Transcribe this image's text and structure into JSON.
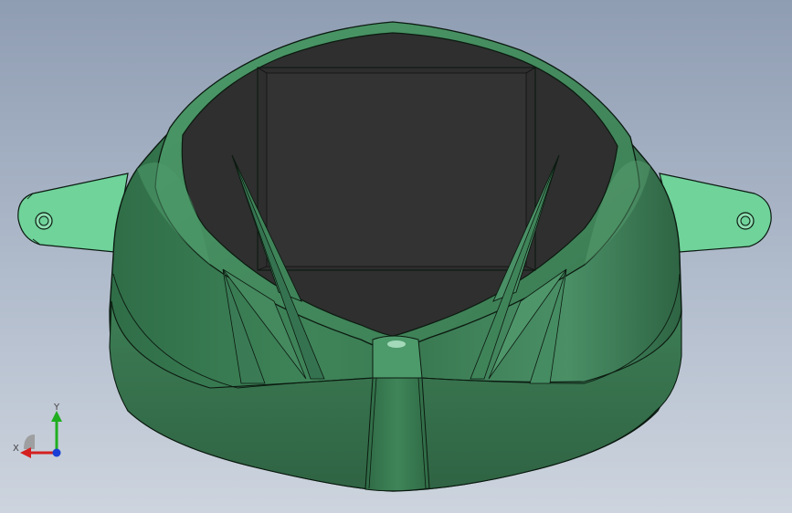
{
  "viewport": {
    "model": "welding-helmet-shell",
    "background_top": "#8f9db3",
    "background_bottom": "#cdd4de",
    "colors": {
      "body": "#3f7f58",
      "body_light": "#5aa173",
      "body_dark": "#2f6343",
      "ear_tab": "#6fd39a",
      "window": "#2f2f2f",
      "edge": "#0b1a10"
    }
  },
  "triad": {
    "x_label": "X",
    "y_label": "Y",
    "x_color": "#d42020",
    "y_color": "#1fae1f",
    "z_color": "#1a3fd6"
  }
}
